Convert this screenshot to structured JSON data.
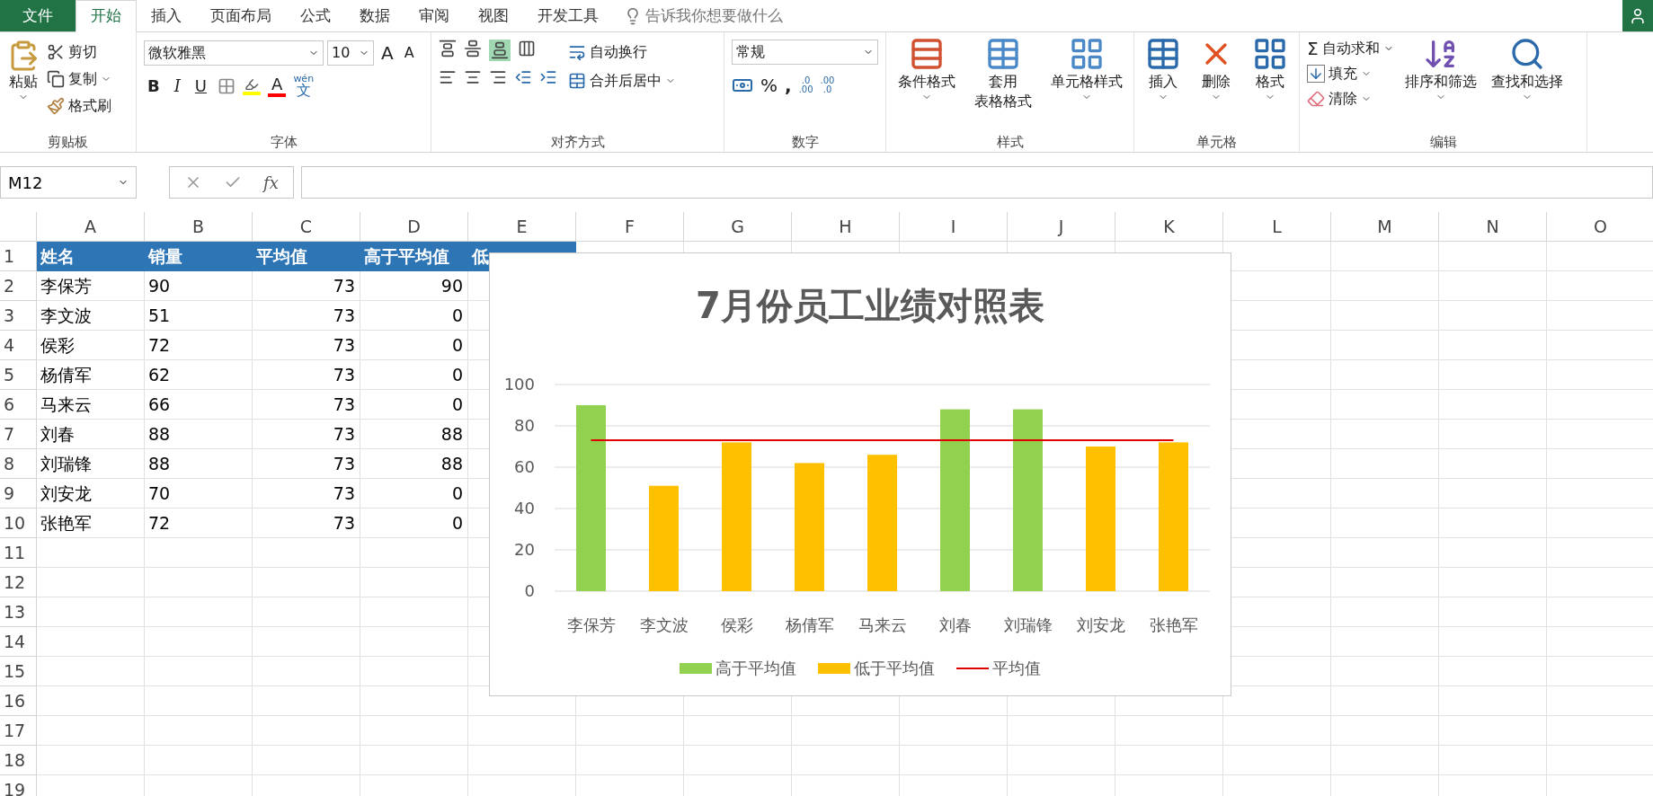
{
  "file_tab": {
    "label": "文件"
  },
  "tabs": [
    {
      "label": "开始",
      "selected": true
    },
    {
      "label": "插入",
      "selected": false
    },
    {
      "label": "页面布局",
      "selected": false
    },
    {
      "label": "公式",
      "selected": false
    },
    {
      "label": "数据",
      "selected": false
    },
    {
      "label": "审阅",
      "selected": false
    },
    {
      "label": "视图",
      "selected": false
    },
    {
      "label": "开发工具",
      "selected": false
    }
  ],
  "tell_me": {
    "placeholder": "告诉我你想要做什么"
  },
  "ribbon": {
    "clipboard": {
      "paste": "粘贴",
      "cut": "剪切",
      "copy": "复制",
      "format_painter": "格式刷",
      "label": "剪贴板"
    },
    "font": {
      "name": "微软雅黑",
      "size": "10",
      "grow": "A",
      "shrink": "A",
      "bold": "B",
      "italic": "I",
      "underline": "U",
      "font_color": "A",
      "phonetic_top": "wén",
      "phonetic_bottom": "文",
      "label": "字体"
    },
    "alignment": {
      "wrap": "自动换行",
      "merge": "合并后居中",
      "label": "对齐方式"
    },
    "number": {
      "format": "常规",
      "percent": "%",
      "comma": ",",
      "inc_top": ".0",
      "inc_bottom": ".00",
      "dec_top": ".00",
      "dec_bottom": ".0",
      "label": "数字"
    },
    "styles": {
      "conditional": "条件格式",
      "table_top": "套用",
      "table_bottom": "表格格式",
      "cell_styles": "单元格样式",
      "label": "样式"
    },
    "cells": {
      "insert": "插入",
      "delete": "删除",
      "format": "格式",
      "label": "单元格"
    },
    "editing": {
      "sigma": "Σ",
      "autosum": "自动求和",
      "fill": "填充",
      "clear": "清除",
      "sort": "排序和筛选",
      "find": "查找和选择",
      "label": "编辑"
    }
  },
  "formula_bar": {
    "name_box": "M12",
    "fx": "fx"
  },
  "sheet": {
    "columns": [
      "A",
      "B",
      "C",
      "D",
      "E",
      "F",
      "G",
      "H",
      "I",
      "J",
      "K",
      "L",
      "M",
      "N",
      "O"
    ],
    "rows": [
      {
        "number": "1",
        "kind": "header",
        "cells": [
          "姓名",
          "销量",
          "平均值",
          "高于平均值",
          "低"
        ]
      },
      {
        "number": "2",
        "kind": "data",
        "cells": [
          "李保芳",
          "90",
          "73",
          "90"
        ]
      },
      {
        "number": "3",
        "kind": "data",
        "cells": [
          "李文波",
          "51",
          "73",
          "0"
        ]
      },
      {
        "number": "4",
        "kind": "data",
        "cells": [
          "侯彩",
          "72",
          "73",
          "0"
        ]
      },
      {
        "number": "5",
        "kind": "data",
        "cells": [
          "杨倩军",
          "62",
          "73",
          "0"
        ]
      },
      {
        "number": "6",
        "kind": "data",
        "cells": [
          "马来云",
          "66",
          "73",
          "0"
        ]
      },
      {
        "number": "7",
        "kind": "data",
        "cells": [
          "刘春",
          "88",
          "73",
          "88"
        ]
      },
      {
        "number": "8",
        "kind": "data",
        "cells": [
          "刘瑞锋",
          "88",
          "73",
          "88"
        ]
      },
      {
        "number": "9",
        "kind": "data",
        "cells": [
          "刘安龙",
          "70",
          "73",
          "0"
        ]
      },
      {
        "number": "10",
        "kind": "data",
        "cells": [
          "张艳军",
          "72",
          "73",
          "0"
        ]
      },
      {
        "number": "11",
        "kind": "data",
        "cells": []
      },
      {
        "number": "12",
        "kind": "data",
        "cells": []
      },
      {
        "number": "13",
        "kind": "data",
        "cells": []
      },
      {
        "number": "14",
        "kind": "data",
        "cells": []
      },
      {
        "number": "15",
        "kind": "data",
        "cells": []
      },
      {
        "number": "16",
        "kind": "data",
        "cells": []
      },
      {
        "number": "17",
        "kind": "data",
        "cells": []
      },
      {
        "number": "18",
        "kind": "data",
        "cells": []
      },
      {
        "number": "19",
        "kind": "data",
        "cells": []
      }
    ]
  },
  "chart": {
    "chart_data": {
      "type": "bar",
      "title": "7月份员工业绩对照表",
      "stacked": true,
      "grid": true,
      "legend": true,
      "categories": [
        "李保芳",
        "李文波",
        "侯彩",
        "杨倩军",
        "马来云",
        "刘春",
        "刘瑞锋",
        "刘安龙",
        "张艳军"
      ],
      "ylim": [
        0,
        100
      ],
      "yticks": [
        0,
        20,
        40,
        60,
        80,
        100
      ],
      "series": [
        {
          "name": "高于平均值",
          "color": "#92d050",
          "type": "bar",
          "values": [
            90,
            0,
            0,
            0,
            0,
            88,
            88,
            0,
            0
          ]
        },
        {
          "name": "低于平均值",
          "color": "#ffc000",
          "type": "bar",
          "values": [
            0,
            51,
            72,
            62,
            66,
            0,
            0,
            70,
            72
          ]
        },
        {
          "name": "平均值",
          "color": "#e00000",
          "type": "line",
          "values": [
            73,
            73,
            73,
            73,
            73,
            73,
            73,
            73,
            73
          ]
        }
      ]
    }
  }
}
